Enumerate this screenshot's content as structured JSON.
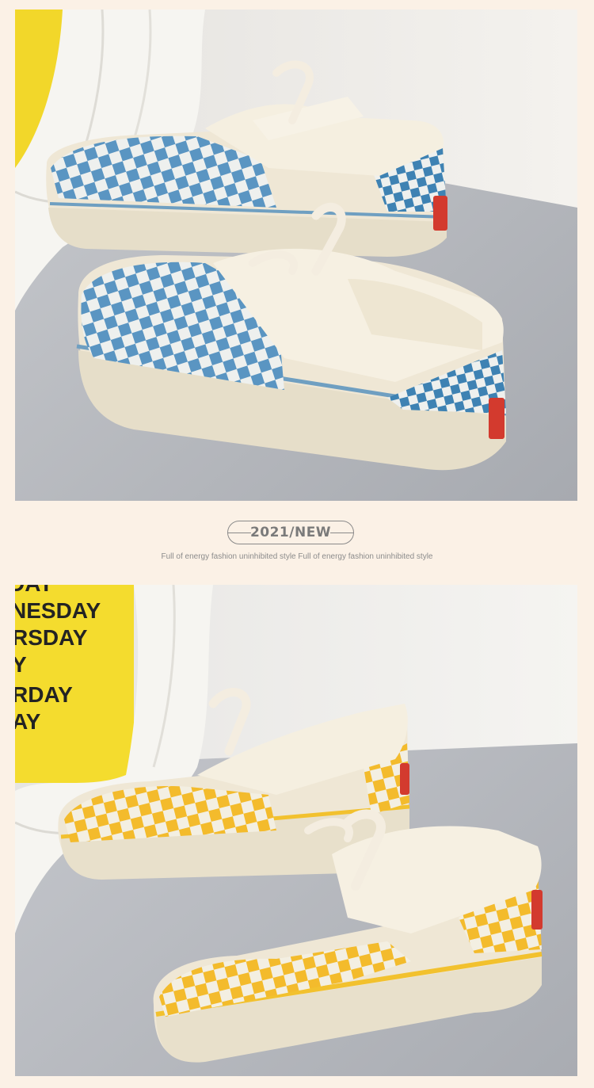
{
  "header": {
    "badge_text": "2021/NEW",
    "tagline": "Full of energy fashion  uninhibited style Full of energy fashion  uninhibited style"
  },
  "photos": {
    "top": {
      "subject": "blue-checkered-canvas-sneakers",
      "accent": "#5a95c2"
    },
    "bottom": {
      "subject": "yellow-checkered-canvas-sneakers",
      "accent": "#f3bb2c"
    }
  },
  "poster": {
    "lines": [
      "DAY",
      "NESDAY",
      "RSDAY",
      "Y",
      "RDAY",
      "AY"
    ]
  },
  "colors": {
    "page_background": "#fbf1e6",
    "canvas_cream": "#f3ecdc",
    "heel_tab_red": "#d33a2e"
  }
}
